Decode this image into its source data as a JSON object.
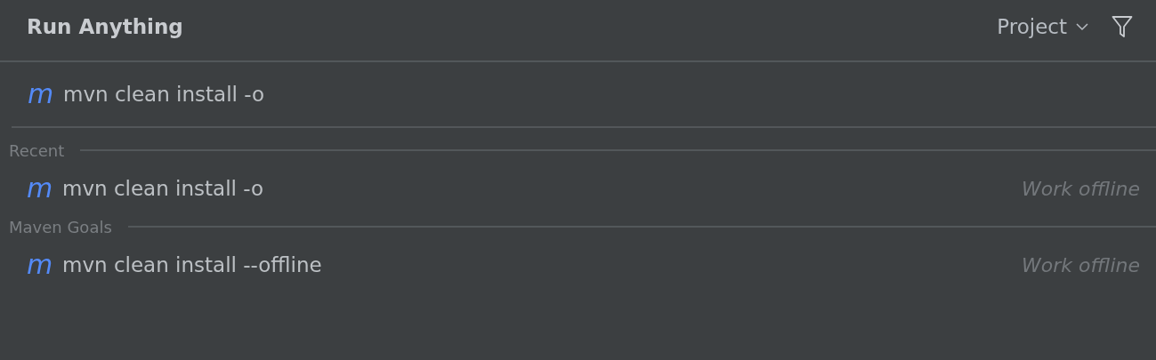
{
  "header": {
    "title": "Run Anything",
    "scope": "Project"
  },
  "search": {
    "icon": "m",
    "value": "mvn clean install -o"
  },
  "groups": [
    {
      "title": "Recent",
      "items": [
        {
          "icon": "m",
          "command": "mvn clean install -o",
          "hint": "Work offline"
        }
      ]
    },
    {
      "title": "Maven Goals",
      "items": [
        {
          "icon": "m",
          "command": "mvn clean install --offline",
          "hint": "Work offline"
        }
      ]
    }
  ]
}
